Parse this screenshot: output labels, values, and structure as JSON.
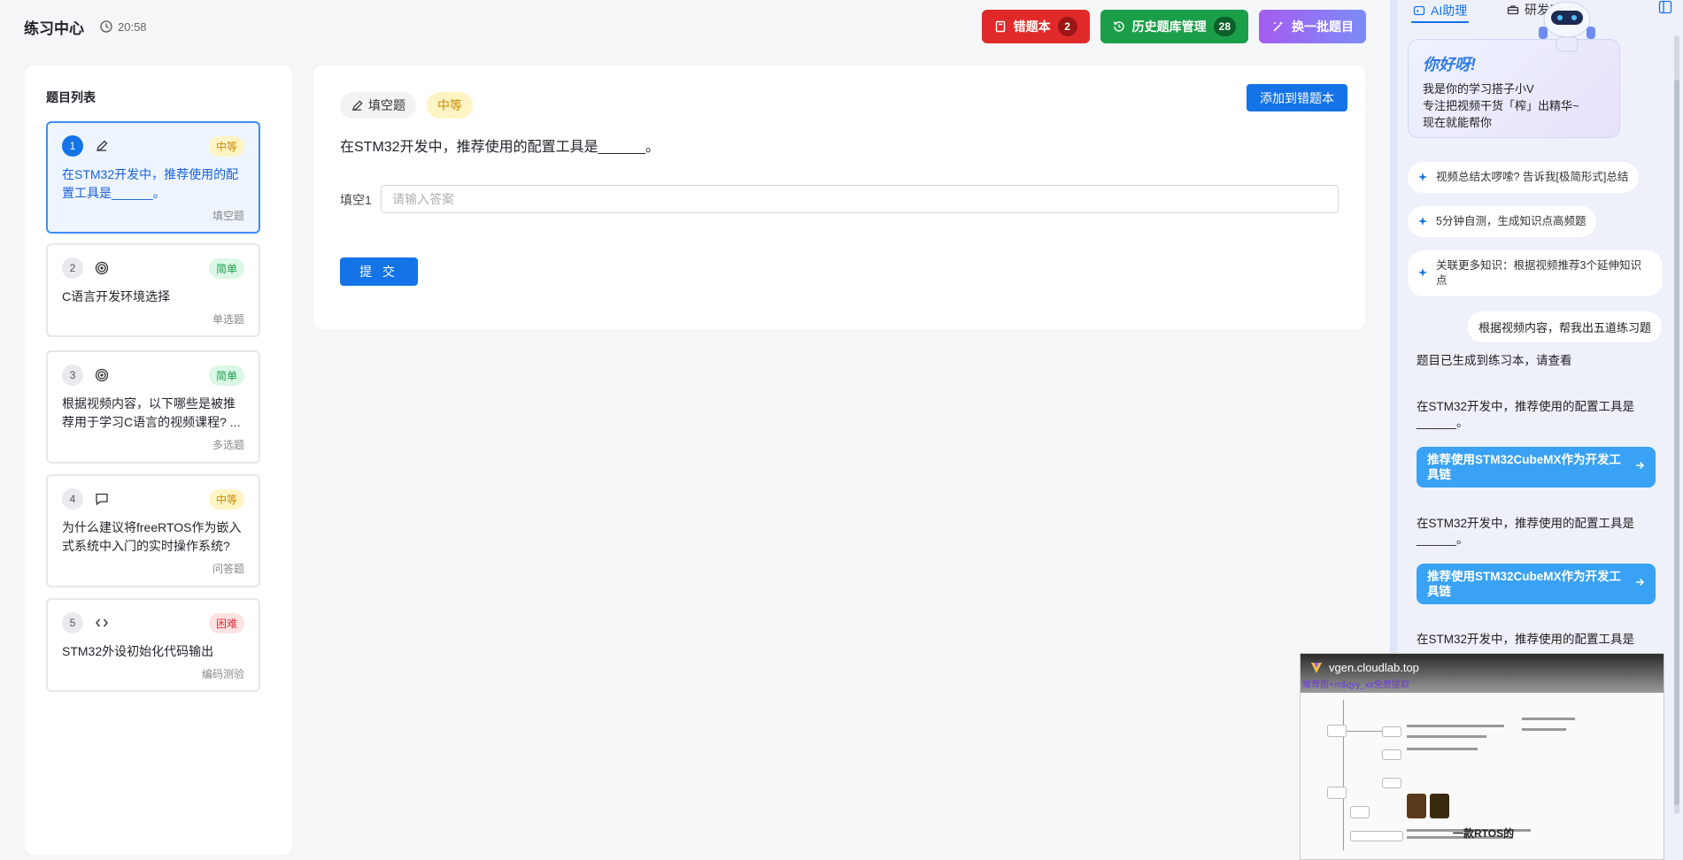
{
  "header": {
    "title": "练习中心",
    "timer": "20:58",
    "wrong_book_label": "错题本",
    "wrong_book_count": "2",
    "history_label": "历史题库管理",
    "history_count": "28",
    "refresh_label": "换一批题目"
  },
  "question_list": {
    "title": "题目列表",
    "items": [
      {
        "num": "1",
        "icon": "pencil-icon",
        "difficulty": "中等",
        "text": "在STM32开发中，推荐使用的配置工具是______。",
        "type": "填空题"
      },
      {
        "num": "2",
        "icon": "target-icon",
        "difficulty": "简单",
        "text": "C语言开发环境选择",
        "type": "单选题"
      },
      {
        "num": "3",
        "icon": "target-icon",
        "difficulty": "简单",
        "text": "根据视频内容，以下哪些是被推荐用于学习C语言的视频课程? ...",
        "type": "多选题"
      },
      {
        "num": "4",
        "icon": "chat-icon",
        "difficulty": "中等",
        "text": "为什么建议将freeRTOS作为嵌入式系统中入门的实时操作系统?",
        "type": "问答题"
      },
      {
        "num": "5",
        "icon": "code-icon",
        "difficulty": "困难",
        "text": "STM32外设初始化代码输出",
        "type": "编码测验"
      }
    ]
  },
  "main": {
    "type_tag": "填空题",
    "difficulty_tag": "中等",
    "add_to_wrong_label": "添加到错题本",
    "question": "在STM32开发中，推荐使用的配置工具是______。",
    "blank_label": "填空1",
    "blank_placeholder": "请输入答案",
    "submit_label": "提 交"
  },
  "assistant": {
    "tab_ai": "AI助理",
    "tab_dev": "研发工具",
    "welcome_hi": "你好呀!",
    "welcome_line1": "我是你的学习搭子小V",
    "welcome_line2": "专注把视频干货「榨」出精华~",
    "welcome_line3": "现在就能帮你",
    "chips": [
      "视频总结太啰嗦? 告诉我[极简形式]总结",
      "5分钟自测，生成知识点高频题",
      "关联更多知识：根据视频推荐3个延伸知识点"
    ],
    "user_msg": "根据视频内容，帮我出五道练习题",
    "bot_msg": "题目已生成到练习本，请查看",
    "q1": "在STM32开发中，推荐使用的配置工具是______。",
    "a1": "推荐使用STM32CubeMX作为开发工具链",
    "q2": "在STM32开发中，推荐使用的配置工具是______。",
    "a2": "推荐使用STM32CubeMX作为开发工具链",
    "q3": "在STM32开发中，推荐使用的配置工具是"
  },
  "video": {
    "domain": "vgen.cloudlab.top",
    "overlay": "推荐图+m$qyy_xx免费提取",
    "caption": "一款RTOS的"
  },
  "colors": {
    "primary": "#1473e6",
    "wrong_book": "#e02a2a",
    "history": "#1b9e48",
    "refresh": "#a55cf0"
  }
}
